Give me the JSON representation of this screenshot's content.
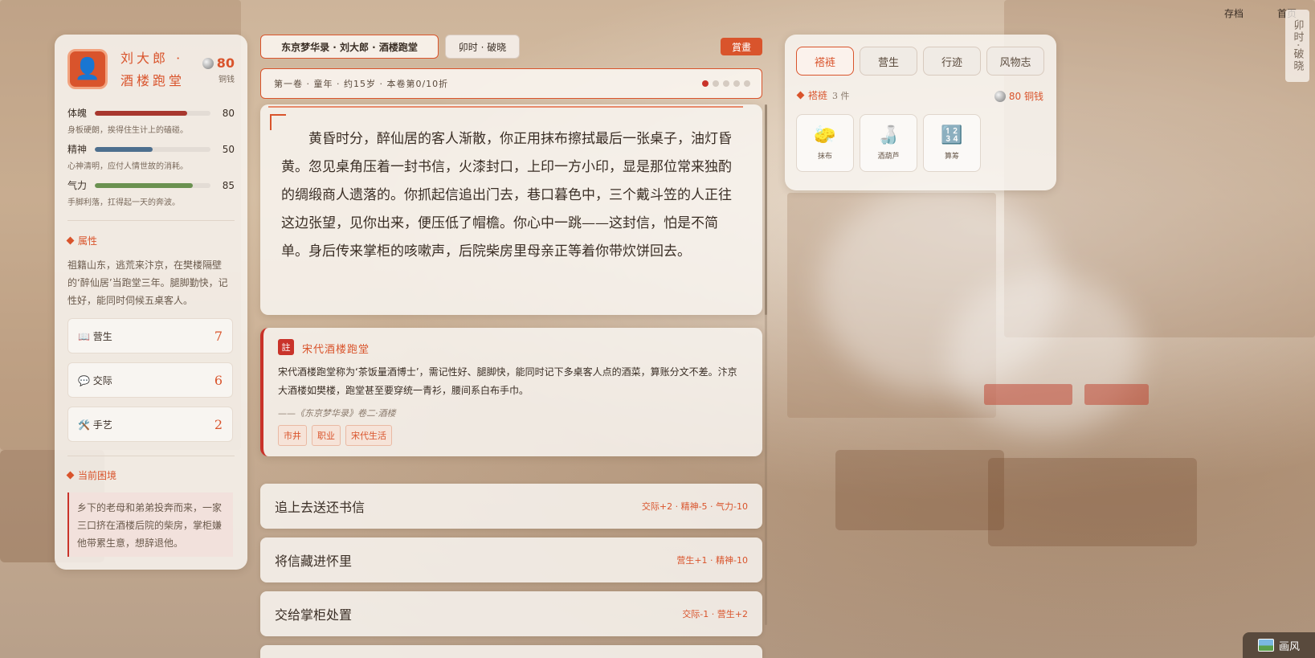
{
  "hero": {
    "avatar_icon": "person-icon",
    "name": "刘大郎 · 酒楼跑堂",
    "coins": "80",
    "coins_label": "铜钱"
  },
  "stats": [
    {
      "label": "体魄",
      "value": "80",
      "ratio": 0.8,
      "color": "#a8372e",
      "desc": "身板硬朗，挨得住生计上的磕碰。"
    },
    {
      "label": "精神",
      "value": "50",
      "ratio": 0.5,
      "color": "#4d6f8e",
      "desc": "心神清明，应付人情世故的消耗。"
    },
    {
      "label": "气力",
      "value": "85",
      "ratio": 0.85,
      "color": "#6a9150",
      "desc": "手脚利落，扛得起一天的奔波。"
    }
  ],
  "attributes": {
    "title": "属性",
    "text": "祖籍山东，逃荒来汴京，在樊楼隔壁的‘醉仙居’当跑堂三年。腿脚勤快，记性好，能同时伺候五桌客人。"
  },
  "skills": [
    {
      "icon": "📖",
      "label": "营生",
      "value": "7"
    },
    {
      "icon": "💬",
      "label": "交际",
      "value": "6"
    },
    {
      "icon": "🛠️",
      "label": "手艺",
      "value": "2"
    }
  ],
  "dilemma": {
    "title": "当前困境",
    "text": "乡下的老母和弟弟投奔而来，一家三口挤在酒楼后院的柴房，掌柜嫌他带累生意，想辞退他。"
  },
  "topbar": {
    "crumb": "东京梦华录 · 刘大郎 · 酒楼跑堂",
    "time": "卯时 · 破晓",
    "reward": "賞畫"
  },
  "progress": {
    "text": "第一卷 · 童年 · 约15岁 · 本卷第0/10折",
    "dots": [
      true,
      false,
      false,
      false,
      false
    ]
  },
  "story": {
    "text": "黄昏时分，醉仙居的客人渐散，你正用抹布擦拭最后一张桌子，油灯昏黄。忽见桌角压着一封书信，火漆封口，上印一方小印，显是那位常来独酌的绸缎商人遗落的。你抓起信追出门去，巷口暮色中，三个戴斗笠的人正往这边张望，见你出来，便压低了帽檐。你心中一跳——这封信，怕是不简单。身后传来掌柜的咳嗽声，后院柴房里母亲正等着你带炊饼回去。"
  },
  "note": {
    "badge": "註",
    "title": "宋代酒楼跑堂",
    "body": "宋代酒楼跑堂称为‘茶饭量酒博士’，需记性好、腿脚快，能同时记下多桌客人点的酒菜，算账分文不差。汴京大酒楼如樊楼，跑堂甚至要穿统一青衫，腰间系白布手巾。",
    "source": "——《东京梦华录》卷二·酒楼",
    "tags": [
      "市井",
      "职业",
      "宋代生活"
    ]
  },
  "choices": [
    {
      "text": "追上去送还书信",
      "effects": "交际+2 · 精神-5 · 气力-10"
    },
    {
      "text": "将信藏进怀里",
      "effects": "营生+1 · 精神-10"
    },
    {
      "text": "交给掌柜处置",
      "effects": "交际-1 · 营生+2"
    }
  ],
  "right": {
    "tabs": [
      "褡裢",
      "营生",
      "行迹",
      "风物志"
    ],
    "inventory_title": "褡裢",
    "inventory_count": "3 件",
    "coins": "80 铜钱",
    "items": [
      {
        "icon": "sponge-icon",
        "glyph": "🧽",
        "label": "抹布"
      },
      {
        "icon": "gourd-icon",
        "glyph": "🍶",
        "label": "酒葫芦"
      },
      {
        "icon": "abacus-icon",
        "glyph": "🔢",
        "label": "算筹"
      }
    ]
  },
  "corner": {
    "save": "存档",
    "home": "首页",
    "vertical_time": "卯时·破晓",
    "painter": "画风"
  }
}
